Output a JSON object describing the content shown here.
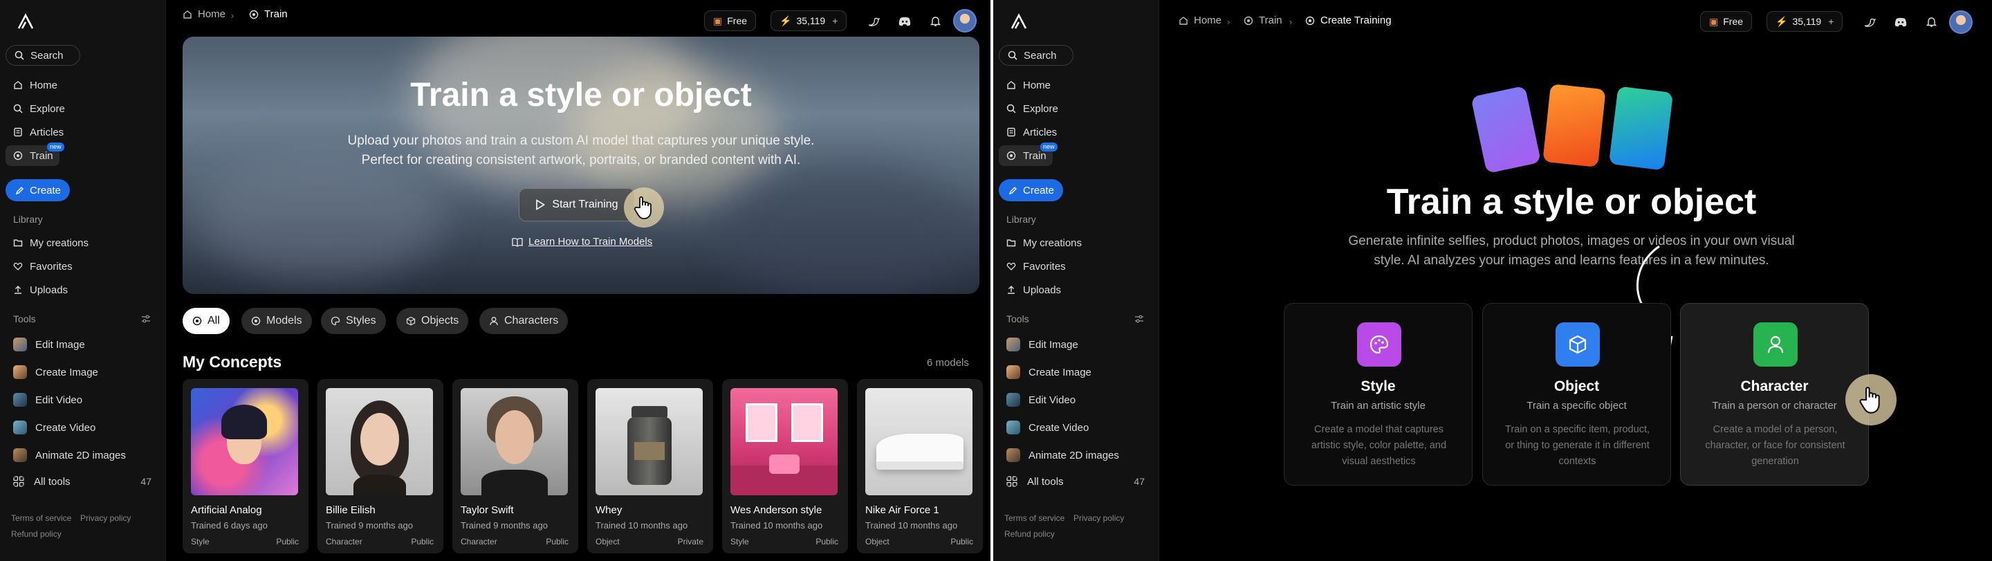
{
  "left": {
    "sidebar": {
      "search_label": "Search",
      "nav": [
        "Home",
        "Explore",
        "Articles",
        "Train"
      ],
      "new_badge": "new",
      "create_label": "Create",
      "library_heading": "Library",
      "library": [
        "My creations",
        "Favorites",
        "Uploads"
      ],
      "tools_heading": "Tools",
      "tools": [
        "Edit Image",
        "Create Image",
        "Edit Video",
        "Create Video",
        "Animate 2D images"
      ],
      "all_tools_label": "All tools",
      "all_tools_count": "47",
      "footer": {
        "terms": "Terms of service",
        "privacy": "Privacy policy",
        "refund": "Refund policy"
      }
    },
    "topbar": {
      "breadcrumb": [
        "Home",
        "Train"
      ],
      "plan": "Free",
      "credits": "35,119"
    },
    "hero": {
      "title": "Train a style or object",
      "subtitle_line1": "Upload your photos and train a custom AI model that captures your unique style.",
      "subtitle_line2": "Perfect for creating consistent artwork, portraits, or branded content with AI.",
      "start_button": "Start Training",
      "learn_link": "Learn How to Train Models"
    },
    "filters": [
      "All",
      "Models",
      "Styles",
      "Objects",
      "Characters"
    ],
    "section_title": "My Concepts",
    "model_count": "6 models",
    "concepts": [
      {
        "name": "Artificial Analog",
        "time": "Trained 6 days ago",
        "tag": "Style",
        "visibility": "Public"
      },
      {
        "name": "Billie Eilish",
        "time": "Trained 9 months ago",
        "tag": "Character",
        "visibility": "Public"
      },
      {
        "name": "Taylor Swift",
        "time": "Trained 9 months ago",
        "tag": "Character",
        "visibility": "Public"
      },
      {
        "name": "Whey",
        "time": "Trained 10 months ago",
        "tag": "Object",
        "visibility": "Private"
      },
      {
        "name": "Wes Anderson style",
        "time": "Trained 10 months ago",
        "tag": "Style",
        "visibility": "Public"
      },
      {
        "name": "Nike Air Force 1",
        "time": "Trained 10 months ago",
        "tag": "Object",
        "visibility": "Public"
      }
    ]
  },
  "right": {
    "sidebar": {
      "search_label": "Search",
      "nav": [
        "Home",
        "Explore",
        "Articles",
        "Train"
      ],
      "new_badge": "new",
      "create_label": "Create",
      "library_heading": "Library",
      "library": [
        "My creations",
        "Favorites",
        "Uploads"
      ],
      "tools_heading": "Tools",
      "tools": [
        "Edit Image",
        "Create Image",
        "Edit Video",
        "Create Video",
        "Animate 2D images"
      ],
      "all_tools_label": "All tools",
      "all_tools_count": "47",
      "footer": {
        "terms": "Terms of service",
        "privacy": "Privacy policy",
        "refund": "Refund policy"
      }
    },
    "topbar": {
      "breadcrumb": [
        "Home",
        "Train",
        "Create Training"
      ],
      "plan": "Free",
      "credits": "35,119"
    },
    "title": "Train a style or object",
    "subtitle_line1": "Generate infinite selfies, product photos, images or videos in your own visual",
    "subtitle_line2": "style. AI analyzes your images and learns features in a few minutes.",
    "options": [
      {
        "title": "Style",
        "subtitle": "Train an artistic style",
        "description": "Create a model that captures artistic style, color palette, and visual aesthetics",
        "color": "#b84be8"
      },
      {
        "title": "Object",
        "subtitle": "Train a specific object",
        "description": "Train on a specific item, product, or thing to generate it in different contexts",
        "color": "#2f7ff0"
      },
      {
        "title": "Character",
        "subtitle": "Train a person or character",
        "description": "Create a model of a person, character, or face for consistent generation",
        "color": "#27b34f"
      }
    ]
  }
}
